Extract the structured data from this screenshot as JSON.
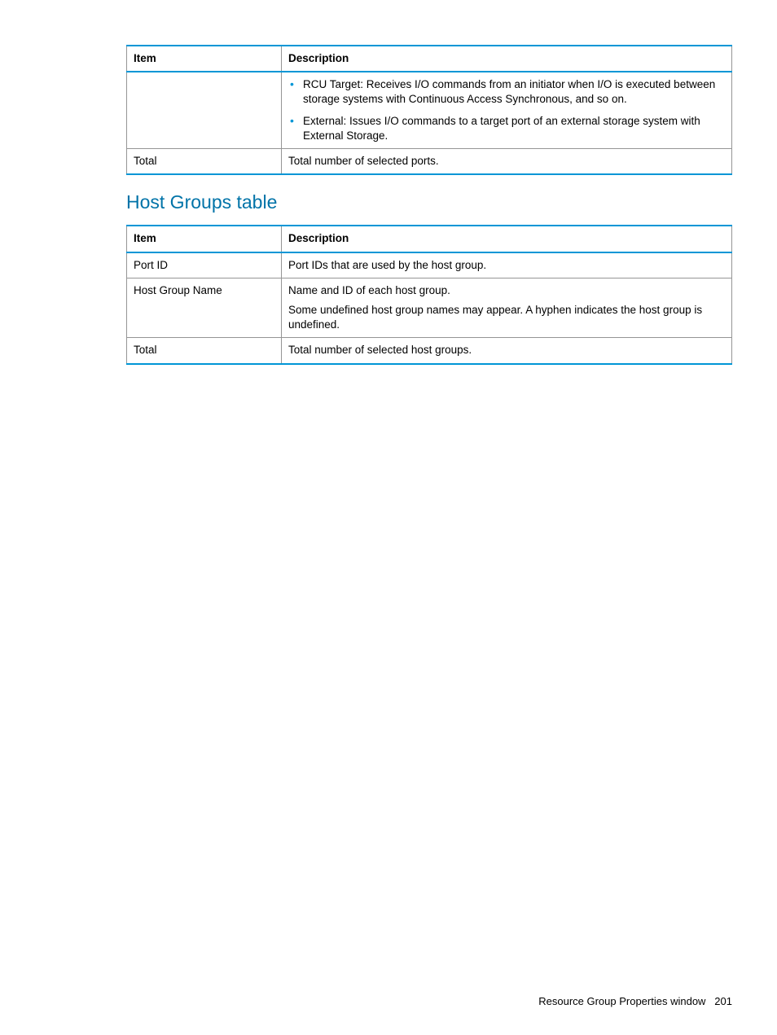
{
  "table1": {
    "headers": {
      "item": "Item",
      "desc": "Description"
    },
    "rows": [
      {
        "item": "",
        "bullets": [
          "RCU Target: Receives I/O commands from an initiator when I/O is executed between storage systems with Continuous Access Synchronous, and so on.",
          "External: Issues I/O commands to a target port of an external storage system with External Storage."
        ]
      },
      {
        "item": "Total",
        "desc": "Total number of selected ports."
      }
    ]
  },
  "section_heading": "Host Groups table",
  "table2": {
    "headers": {
      "item": "Item",
      "desc": "Description"
    },
    "rows": [
      {
        "item": "Port ID",
        "desc": "Port IDs that are used by the host group."
      },
      {
        "item": "Host Group Name",
        "desc_lines": [
          "Name and ID of each host group.",
          "Some undefined host group names may appear. A hyphen indicates the host group is undefined."
        ]
      },
      {
        "item": "Total",
        "desc": "Total number of selected host groups."
      }
    ]
  },
  "footer": {
    "text": "Resource Group Properties window",
    "page": "201"
  }
}
